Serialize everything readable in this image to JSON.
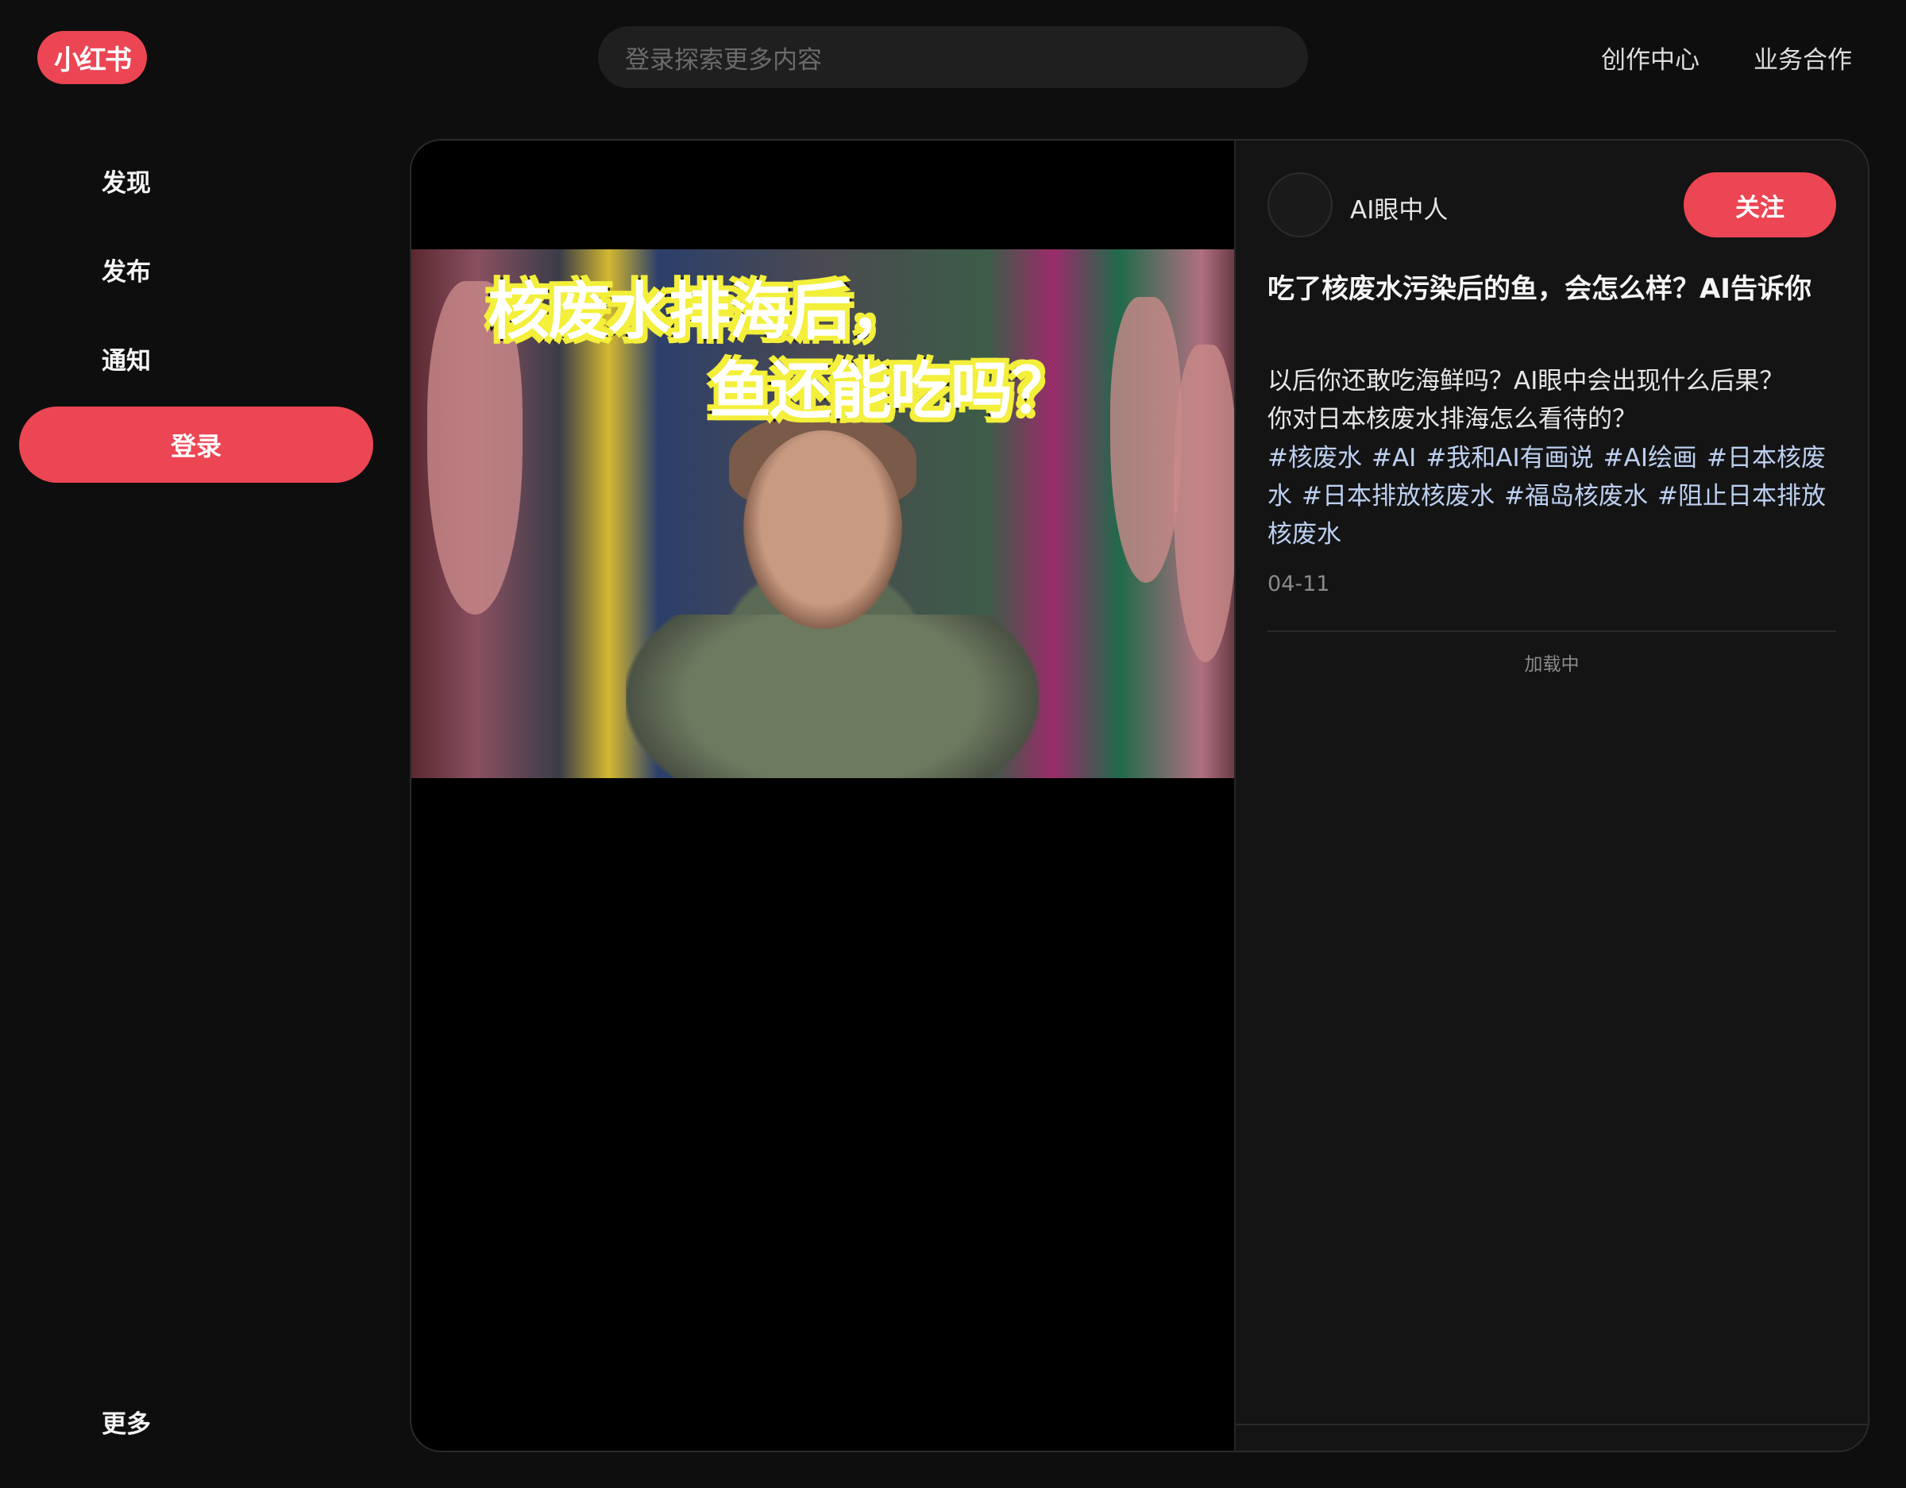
{
  "app": {
    "logo_text": "小红书",
    "accent_color": "#ec4553"
  },
  "search": {
    "placeholder": "登录探索更多内容"
  },
  "header": {
    "links": [
      "创作中心",
      "业务合作"
    ]
  },
  "sidebar": {
    "items": [
      {
        "label": "发现"
      },
      {
        "label": "发布"
      },
      {
        "label": "通知"
      }
    ],
    "login_label": "登录",
    "more_label": "更多"
  },
  "media": {
    "caption_line1": "核废水排海后，",
    "caption_line2": "鱼还能吃吗？"
  },
  "note": {
    "author": "AI眼中人",
    "follow_label": "关注",
    "title": "吃了核废水污染后的鱼，会怎么样？AI告诉你",
    "body_line1": "以后你还敢吃海鲜吗？AI眼中会出现什么后果？",
    "body_line2": "你对日本核废水排海怎么看待的？",
    "tags": [
      "#核废水",
      "#AI",
      "#我和AI有画说",
      "#AI绘画",
      "#日本核废水",
      "#日本排放核废水",
      "#福岛核废水",
      "#阻止日本排放核废水"
    ],
    "date": "04-11",
    "loading_text": "加载中"
  }
}
